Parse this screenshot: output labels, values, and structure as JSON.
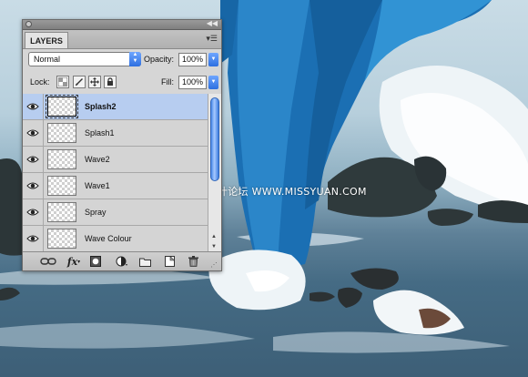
{
  "panel": {
    "tab_label": "LAYERS",
    "blend_mode": "Normal",
    "opacity_label": "Opacity:",
    "opacity_value": "100%",
    "lock_label": "Lock:",
    "fill_label": "Fill:",
    "fill_value": "100%",
    "layers": [
      {
        "name": "Splash2",
        "selected": true
      },
      {
        "name": "Splash1",
        "selected": false
      },
      {
        "name": "Wave2",
        "selected": false
      },
      {
        "name": "Wave1",
        "selected": false
      },
      {
        "name": "Spray",
        "selected": false
      },
      {
        "name": "Wave Colour",
        "selected": false
      }
    ],
    "footer_icons": [
      "link-layers-icon",
      "fx-icon",
      "layer-mask-icon",
      "adjustment-layer-icon",
      "new-group-icon",
      "new-layer-icon",
      "trash-icon"
    ],
    "fx_label": "fx"
  },
  "watermark": "思缘设计论坛 WWW.MISSYUAN.COM",
  "colors": {
    "selection": "#b7cdf0",
    "scroll_thumb": "#4a89e8",
    "fabric": "#1b6fb3"
  }
}
